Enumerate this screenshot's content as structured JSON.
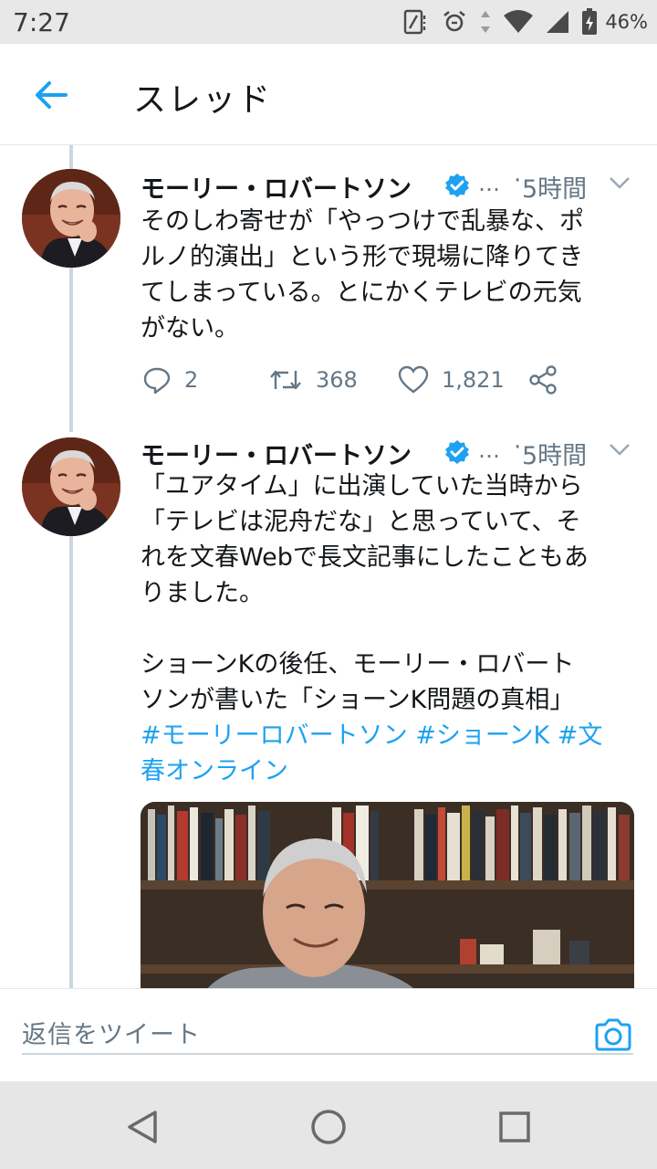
{
  "status_bar": {
    "time": "7:27",
    "battery": "46%"
  },
  "header": {
    "title": "スレッド"
  },
  "tweets": [
    {
      "name": "モーリー・ロバートソン",
      "ellipsis": "…",
      "time": "5時間",
      "text": "そのしわ寄せが「やっつけで乱暴な、ポ\nルノ的演出」という形で現場に降りてき\nてしまっている。とにかくテレビの元気\nがない。",
      "replies": "2",
      "retweets": "368",
      "likes": "1,821"
    },
    {
      "name": "モーリー・ロバートソン",
      "ellipsis": "…",
      "time": "5時間",
      "text": "「ユアタイム」に出演していた当時から\n「テレビは泥舟だな」と思っていて、そ\nれを文春Webで長文記事にしたこともあ\nりました。\n\nショーンKの後任、モーリー・ロバート\nソンが書いた「ショーンK問題の真相」",
      "hashtags": "#モーリーロバートソン #ショーンK #文\n春オンライン"
    }
  ],
  "reply_bar": {
    "placeholder": "返信をツイート"
  },
  "colors": {
    "accent": "#1da1f2",
    "muted": "#657786",
    "thread_line": "#ccd6dd"
  }
}
